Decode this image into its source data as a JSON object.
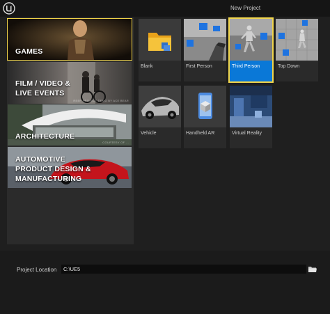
{
  "window": {
    "title": "New Project",
    "logo_icon": "unreal-engine-logo-icon"
  },
  "categories": [
    {
      "label_lines": [
        "GAMES"
      ],
      "selected": true,
      "scene": "games"
    },
    {
      "label_lines": [
        "FILM / VIDEO &",
        "LIVE EVENTS"
      ],
      "selected": false,
      "scene": "film",
      "watermark": "REEF PROJECT DEMO BY ACE BEAR"
    },
    {
      "label_lines": [
        "ARCHITECTURE"
      ],
      "selected": false,
      "scene": "architecture",
      "watermark": "COURTESY OF ..."
    },
    {
      "label_lines": [
        "AUTOMOTIVE",
        "PRODUCT DESIGN &",
        "MANUFACTURING"
      ],
      "selected": false,
      "scene": "automotive"
    }
  ],
  "templates": [
    {
      "name": "Blank",
      "icon": "folder-icon",
      "selected": false
    },
    {
      "name": "First Person",
      "icon": "first-person-scene-icon",
      "selected": false
    },
    {
      "name": "Third Person",
      "icon": "mannequin-icon",
      "selected": true
    },
    {
      "name": "Top Down",
      "icon": "top-down-scene-icon",
      "selected": false
    },
    {
      "name": "Vehicle",
      "icon": "car-icon",
      "selected": false
    },
    {
      "name": "Handheld AR",
      "icon": "phone-cube-icon",
      "selected": false
    },
    {
      "name": "Virtual Reality",
      "icon": "vr-room-icon",
      "selected": false
    }
  ],
  "project_location": {
    "label": "Project Location",
    "value": "C:\\UE5",
    "browse_icon": "folder-browse-icon"
  },
  "colors": {
    "selection_outline": "#f2d64b",
    "selected_tile": "#0a78d7",
    "background": "#1b1b1b"
  }
}
